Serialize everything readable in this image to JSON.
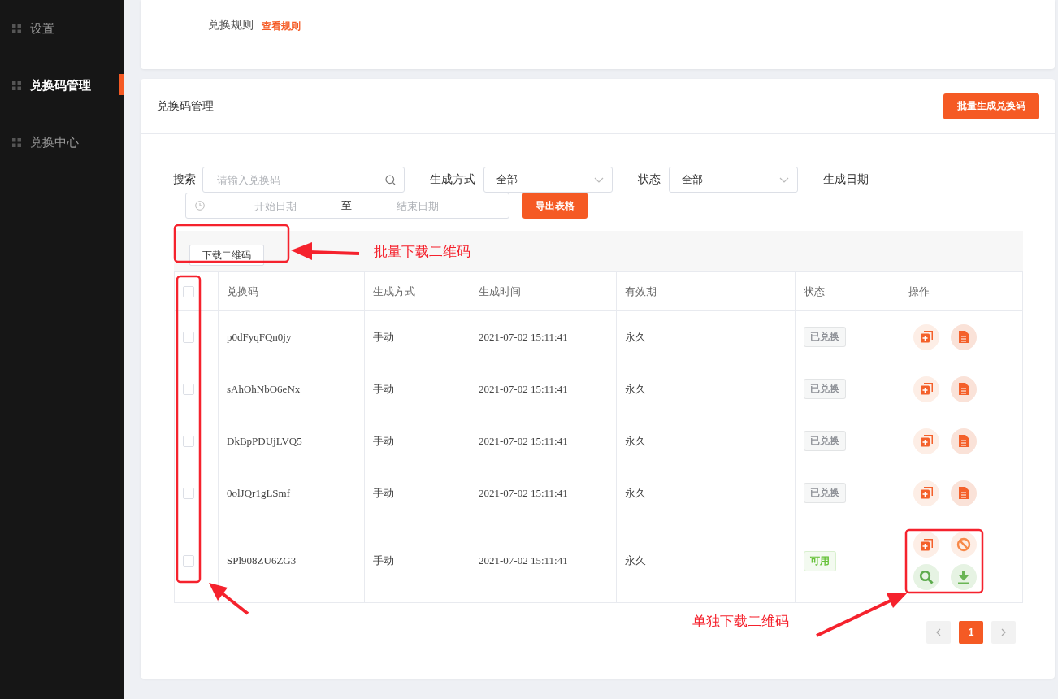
{
  "sidebar": {
    "items": [
      {
        "label": "设置",
        "selected": false
      },
      {
        "label": "兑换码管理",
        "selected": true
      },
      {
        "label": "兑换中心",
        "selected": false
      }
    ]
  },
  "rules_card": {
    "label": "兑换规则",
    "link": "查看规则"
  },
  "panel": {
    "title": "兑换码管理",
    "primary_button": "批量生成兑换码"
  },
  "filters": {
    "search": {
      "label": "搜索",
      "placeholder": "请输入兑换码"
    },
    "method": {
      "label": "生成方式",
      "value": "全部"
    },
    "status": {
      "label": "状态",
      "value": "全部"
    },
    "date": {
      "label": "生成日期",
      "start": {
        "placeholder": "开始日期"
      },
      "separator": "至",
      "end": {
        "placeholder": "结束日期"
      }
    },
    "export_button": "导出表格"
  },
  "toolbar": {
    "download_button": "下载二维码"
  },
  "table": {
    "header_checkbox": {
      "checked": false
    },
    "columns": [
      "兑换码",
      "生成方式",
      "生成时间",
      "有效期",
      "状态",
      "操作"
    ],
    "rows": [
      {
        "checked": false,
        "code": "p0dFyqFQn0jy",
        "method": "手动",
        "time": "2021-07-02 15:11:41",
        "validity": "永久",
        "status": "已兑换",
        "color": "#909399",
        "actions": [
          {
            "kind": "copy"
          },
          {
            "kind": "document"
          }
        ]
      },
      {
        "checked": false,
        "code": "sAhOhNbO6eNx",
        "method": "手动",
        "time": "2021-07-02 15:11:41",
        "validity": "永久",
        "status": "已兑换",
        "color": "#909399",
        "actions": [
          {
            "kind": "copy"
          },
          {
            "kind": "document"
          }
        ]
      },
      {
        "checked": false,
        "code": "DkBpPDUjLVQ5",
        "method": "手动",
        "time": "2021-07-02 15:11:41",
        "validity": "永久",
        "status": "已兑换",
        "color": "#909399",
        "actions": [
          {
            "kind": "copy"
          },
          {
            "kind": "document"
          }
        ]
      },
      {
        "checked": false,
        "code": "0olJQr1gLSmf",
        "method": "手动",
        "time": "2021-07-02 15:11:41",
        "validity": "永久",
        "status": "已兑换",
        "color": "#909399",
        "actions": [
          {
            "kind": "copy"
          },
          {
            "kind": "document"
          }
        ]
      },
      {
        "checked": false,
        "code": "SPl908ZU6ZG3",
        "method": "手动",
        "time": "2021-07-02 15:11:41",
        "validity": "永久",
        "status": "可用",
        "color": "#67c23a",
        "actions": [
          {
            "kind": "copy"
          },
          {
            "kind": "ban"
          },
          {
            "kind": "search"
          },
          {
            "kind": "download"
          }
        ]
      }
    ]
  },
  "pagination": {
    "pages": [
      {
        "label": "1",
        "selected": true
      }
    ]
  },
  "annotations": [
    {
      "text": "批量下载二维码"
    },
    {
      "text": "单独下载二维码"
    }
  ]
}
